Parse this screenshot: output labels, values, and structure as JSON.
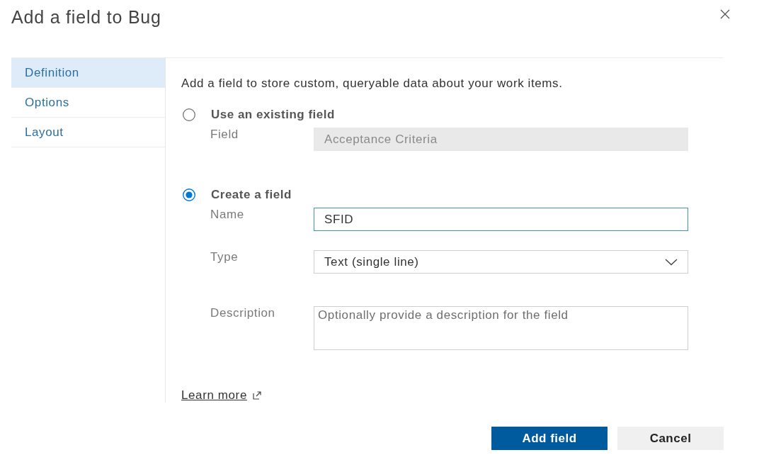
{
  "dialog": {
    "title": "Add a field to Bug"
  },
  "tabs": [
    {
      "label": "Definition",
      "selected": true
    },
    {
      "label": "Options",
      "selected": false
    },
    {
      "label": "Layout",
      "selected": false
    }
  ],
  "intro": "Add a field to store custom, queryable data about your work items.",
  "choices": [
    {
      "label": "Use an existing field",
      "selected": false,
      "fields": [
        {
          "kind": "input",
          "label": "Field",
          "value": "Acceptance Criteria",
          "disabled": true,
          "focused": false
        }
      ]
    },
    {
      "label": "Create a field",
      "selected": true,
      "fields": [
        {
          "kind": "input",
          "label": "Name",
          "value": "SFID",
          "disabled": false,
          "focused": true
        },
        {
          "kind": "select",
          "label": "Type",
          "value": "Text (single line)",
          "disabled": false,
          "focused": false
        },
        {
          "kind": "textarea",
          "label": "Description",
          "placeholder": "Optionally provide a description for the field",
          "disabled": false,
          "focused": false
        }
      ]
    }
  ],
  "learn_more": "Learn more",
  "buttons": [
    {
      "label": "Add field",
      "kind": "primary"
    },
    {
      "label": "Cancel",
      "kind": "secondary"
    }
  ]
}
